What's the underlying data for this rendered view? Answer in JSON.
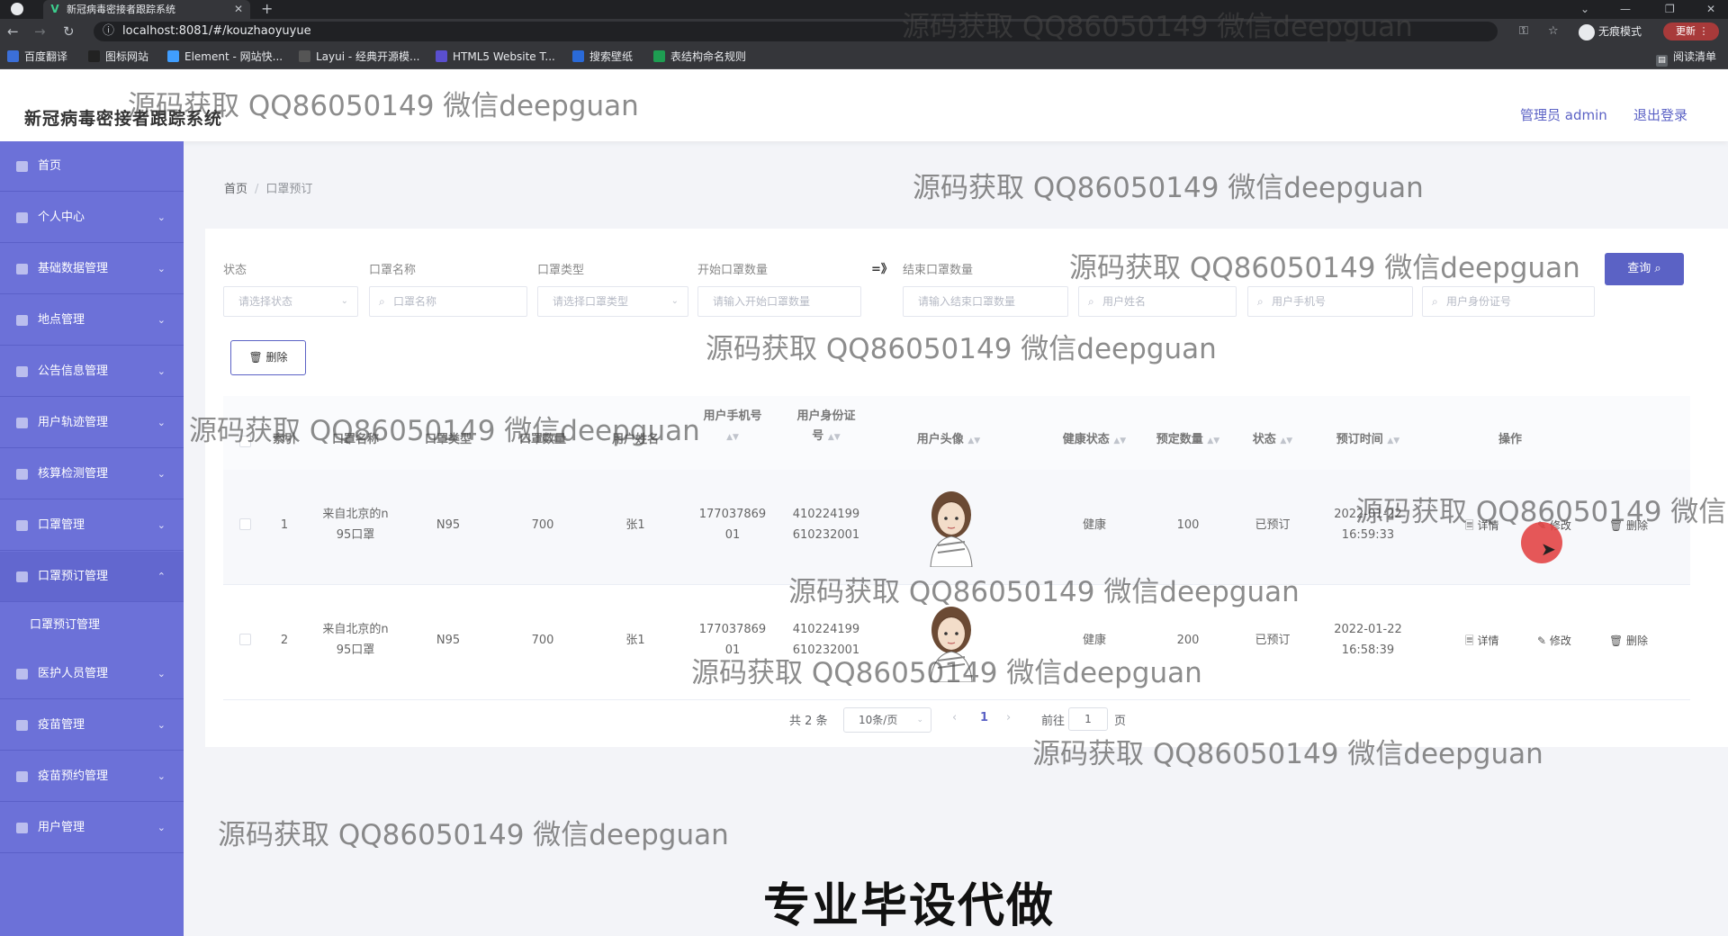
{
  "browser": {
    "tab_title": "新冠病毒密接者跟踪系统",
    "tab_close": "✕",
    "new_tab": "+",
    "url": "localhost:8081/#/kouzhaoyuyue",
    "incognito_label": "无痕模式",
    "update_label": "更新",
    "reading_list": "阅读清单",
    "bookmarks": [
      {
        "label": "百度翻译",
        "icon": "translate-icon",
        "color": "#3b6fd8"
      },
      {
        "label": "图标网站",
        "icon": "flag-icon",
        "color": "#222"
      },
      {
        "label": "Element - 网站快...",
        "icon": "element-icon",
        "color": "#409eff"
      },
      {
        "label": "Layui - 经典开源模...",
        "icon": "layui-icon",
        "color": "#555"
      },
      {
        "label": "HTML5 Website T...",
        "icon": "html5-icon",
        "color": "#5a4fcf"
      },
      {
        "label": "搜索壁纸",
        "icon": "wallpaper-icon",
        "color": "#2a6ad8"
      },
      {
        "label": "表结构命名规则",
        "icon": "doc-icon",
        "color": "#1e9e52"
      }
    ]
  },
  "header": {
    "title": "新冠病毒密接者跟踪系统",
    "admin": "管理员 admin",
    "logout": "退出登录"
  },
  "sidebar": {
    "items": [
      {
        "label": "首页",
        "icon": "home-icon",
        "arrow": ""
      },
      {
        "label": "个人中心",
        "icon": "user-icon",
        "arrow": "⌄"
      },
      {
        "label": "基础数据管理",
        "icon": "list-icon",
        "arrow": "⌄"
      },
      {
        "label": "地点管理",
        "icon": "location-icon",
        "arrow": "⌄"
      },
      {
        "label": "公告信息管理",
        "icon": "notice-icon",
        "arrow": "⌄"
      },
      {
        "label": "用户轨迹管理",
        "icon": "track-icon",
        "arrow": "⌄"
      },
      {
        "label": "核算检测管理",
        "icon": "test-icon",
        "arrow": "⌄"
      },
      {
        "label": "口罩管理",
        "icon": "mask-icon",
        "arrow": "⌄"
      },
      {
        "label": "口罩预订管理",
        "icon": "booking-icon",
        "arrow": "⌃"
      },
      {
        "label": "医护人员管理",
        "icon": "medic-icon",
        "arrow": "⌄"
      },
      {
        "label": "疫苗管理",
        "icon": "chart-icon",
        "arrow": "⌄"
      },
      {
        "label": "疫苗预约管理",
        "icon": "send-icon",
        "arrow": "⌄"
      },
      {
        "label": "用户管理",
        "icon": "users-icon",
        "arrow": "⌄"
      }
    ],
    "submenu_label": "口罩预订管理"
  },
  "breadcrumb": {
    "home": "首页",
    "sep": "/",
    "current": "口罩预订"
  },
  "filters": {
    "status_label": "状态",
    "status_placeholder": "请选择状态",
    "mask_name_label": "口罩名称",
    "mask_name_placeholder": "口罩名称",
    "mask_type_label": "口罩类型",
    "mask_type_placeholder": "请选择口罩类型",
    "start_qty_label": "开始口罩数量",
    "start_qty_placeholder": "请输入开始口罩数量",
    "range_symbol": "=》",
    "end_qty_label": "结束口罩数量",
    "end_qty_placeholder": "请输入结束口罩数量",
    "user_name_placeholder": "用户姓名",
    "user_phone_placeholder": "用户手机号",
    "user_id_placeholder": "用户身份证号",
    "query_button": "查询 ⌕",
    "delete_button": "🗑 删除"
  },
  "table": {
    "headers": {
      "index": "索引",
      "mask_name": "口罩名称",
      "mask_type": "口罩类型",
      "mask_qty": "口罩数量",
      "user_name": "用户姓名",
      "phone_line1": "用户手机号",
      "id_line1": "用户身份证",
      "id_line2": "号",
      "avatar": "用户头像",
      "health": "健康状态",
      "book_qty": "预定数量",
      "status": "状态",
      "book_time": "预订时间",
      "actions": "操作"
    },
    "rows": [
      {
        "index": "1",
        "mask_name_1": "来自北京的n",
        "mask_name_2": "95口罩",
        "mask_type": "N95",
        "mask_qty": "700",
        "user_name": "张1",
        "phone_1": "177037869",
        "phone_2": "01",
        "id_1": "410224199",
        "id_2": "610232001",
        "health": "健康",
        "book_qty": "100",
        "status": "已预订",
        "time_1": "2022-01-22",
        "time_2": "16:59:33"
      },
      {
        "index": "2",
        "mask_name_1": "来自北京的n",
        "mask_name_2": "95口罩",
        "mask_type": "N95",
        "mask_qty": "700",
        "user_name": "张1",
        "phone_1": "177037869",
        "phone_2": "01",
        "id_1": "410224199",
        "id_2": "610232001",
        "health": "健康",
        "book_qty": "200",
        "status": "已预订",
        "time_1": "2022-01-22",
        "time_2": "16:58:39"
      }
    ],
    "action_detail": "🗏 详情",
    "action_edit": "✎ 修改",
    "action_delete": "🗑 删除"
  },
  "pagination": {
    "total": "共 2 条",
    "page_size": "10条/页",
    "prev": "‹",
    "current": "1",
    "next": "›",
    "goto_label": "前往",
    "goto_value": "1",
    "page_unit": "页"
  },
  "overlay": {
    "watermark": "源码获取 QQ86050149 微信deepguan",
    "caption": "专业毕设代做"
  }
}
